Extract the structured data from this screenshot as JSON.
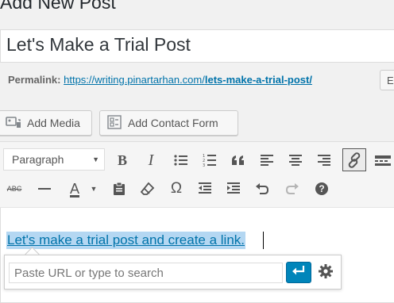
{
  "page": {
    "heading": "Add New Post"
  },
  "post": {
    "title": "Let's Make a Trial Post"
  },
  "permalink": {
    "label": "Permalink:",
    "base_url": "https://writing.pinartarhan.com/",
    "slug": "lets-make-a-trial-post/",
    "edit_label": "Ed"
  },
  "media_buttons": {
    "add_media": "Add Media",
    "add_contact_form": "Add Contact Form"
  },
  "toolbar": {
    "format_select": "Paragraph",
    "strikethrough_label": "ABC",
    "bold_label": "B",
    "italic_label": "I",
    "text_color_label": "A",
    "omega_label": "Ω",
    "help_label": "?"
  },
  "content": {
    "link_text": "Let's make a trial post and create a link."
  },
  "link_popup": {
    "placeholder": "Paste URL or type to search"
  },
  "colors": {
    "link": "#0073aa",
    "selection": "#b4d7f2",
    "primary_button": "#0085ba"
  }
}
